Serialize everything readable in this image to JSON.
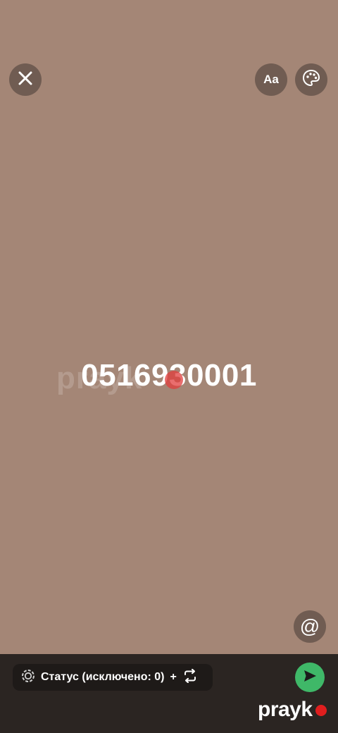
{
  "status_text": "0516930001",
  "toolbar": {
    "font_label": "Aa"
  },
  "audience": {
    "label": "Статус (исключено: 0)",
    "plus": "+"
  },
  "watermark": {
    "faint": "prayk",
    "brand": "prayk"
  },
  "icons": {
    "close": "close-icon",
    "font": "text-style-icon",
    "palette": "palette-icon",
    "mention": "at-icon",
    "status": "status-ring-icon",
    "swap": "repeat-icon",
    "send": "send-icon"
  },
  "colors": {
    "background": "#a48676",
    "bottom_bar": "#2b2522",
    "send": "#3fb868",
    "brand_dot": "#e01e1e"
  }
}
